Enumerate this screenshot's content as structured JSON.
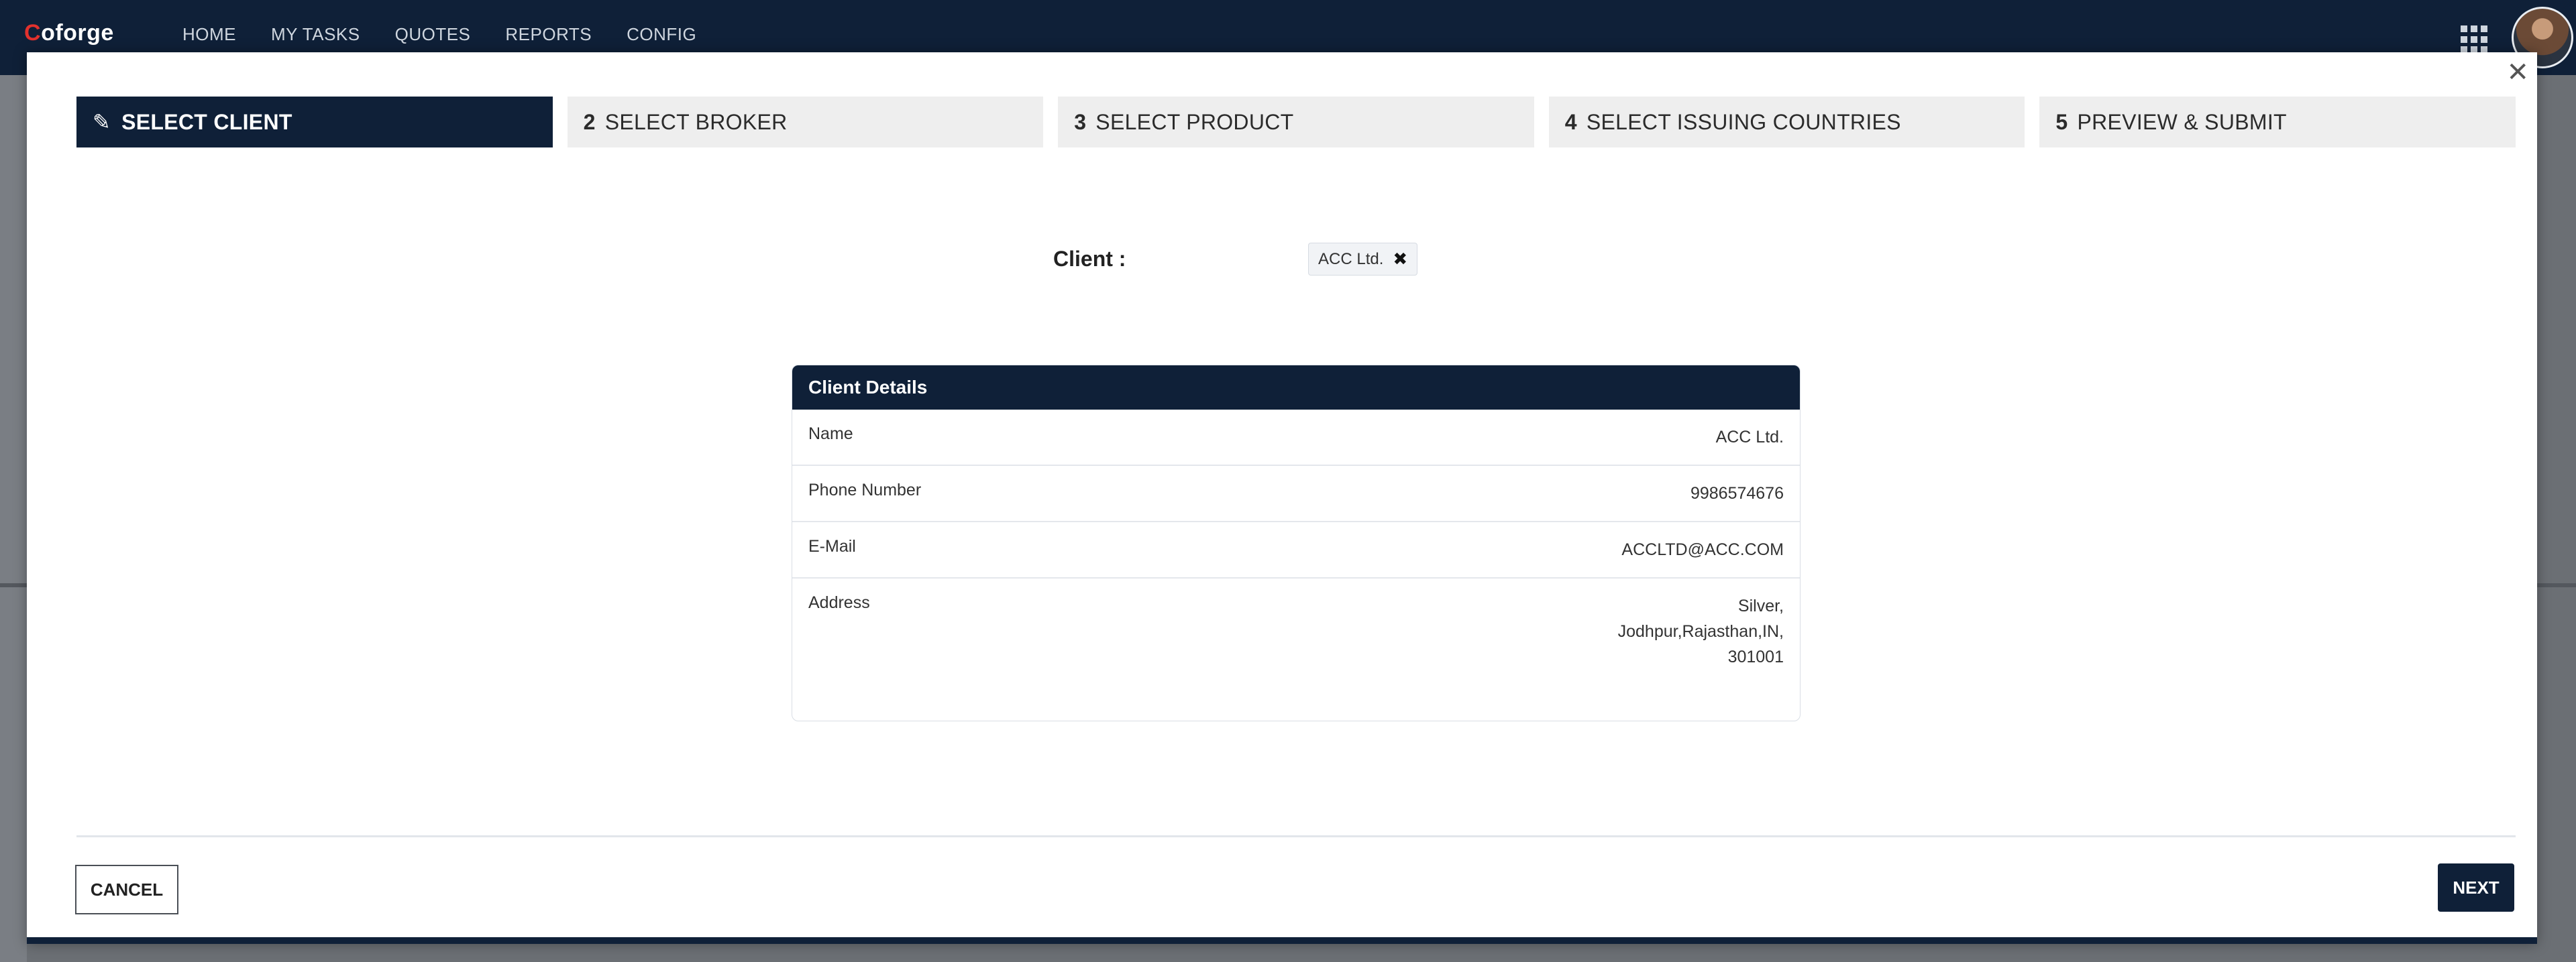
{
  "app": {
    "logo_mark": "C",
    "logo_text": "oforge"
  },
  "nav": [
    {
      "label": "HOME"
    },
    {
      "label": "MY TASKS"
    },
    {
      "label": "QUOTES"
    },
    {
      "label": "REPORTS"
    },
    {
      "label": "CONFIG"
    }
  ],
  "modal": {
    "close_glyph": "✕",
    "steps": [
      {
        "num": "",
        "label": "SELECT CLIENT",
        "icon": "pencil-icon"
      },
      {
        "num": "2",
        "label": "SELECT BROKER"
      },
      {
        "num": "3",
        "label": "SELECT PRODUCT"
      },
      {
        "num": "4",
        "label": "SELECT ISSUING COUNTRIES"
      },
      {
        "num": "5",
        "label": "PREVIEW & SUBMIT"
      }
    ],
    "client": {
      "label": "Client :",
      "chip": "ACC Ltd.",
      "chip_remove": "✖"
    },
    "details": {
      "title": "Client Details",
      "rows": [
        {
          "label": "Name",
          "value": "ACC Ltd."
        },
        {
          "label": "Phone Number",
          "value": "9986574676"
        },
        {
          "label": "E-Mail",
          "value": "ACCLTD@ACC.COM"
        },
        {
          "label": "Address",
          "lines": [
            "Silver,",
            "Jodhpur,Rajasthan,IN,",
            "301001"
          ]
        }
      ]
    },
    "buttons": {
      "cancel": "CANCEL",
      "next": "NEXT"
    }
  },
  "colors": {
    "navy": "#0f2038",
    "logo_accent": "#e2312d"
  }
}
